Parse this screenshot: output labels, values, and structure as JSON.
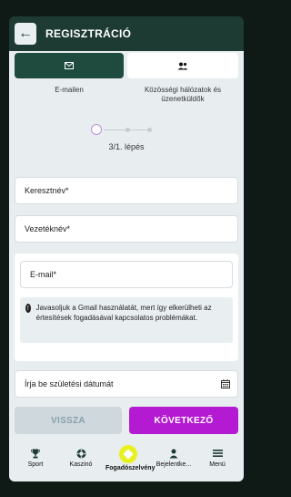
{
  "header": {
    "title": "REGISZTRÁCIÓ"
  },
  "tabs": [
    {
      "label": "E-mailen",
      "icon": "envelope-icon"
    },
    {
      "label": "Közösségi hálózatok és üzenetküldők",
      "icon": "users-icon"
    }
  ],
  "progress": {
    "step_text": "3/1. lépés"
  },
  "fields": {
    "first_name": {
      "placeholder": "Keresztnév*"
    },
    "last_name": {
      "placeholder": "Vezetéknév*"
    },
    "email": {
      "placeholder": "E-mail*"
    },
    "birthdate": {
      "placeholder": "Írja be születési dátumát"
    }
  },
  "notice": {
    "text": "Javasoljuk a Gmail használatát, mert így elkerülheti az értesítések fogadásával kapcsolatos problémákat."
  },
  "buttons": {
    "back": "VISSZA",
    "next": "KÖVETKEZŐ"
  },
  "bottom_nav": [
    {
      "label": "Sport",
      "icon": "trophy-icon"
    },
    {
      "label": "Kaszinó",
      "icon": "chip-icon"
    },
    {
      "label": "Fogadószelvény",
      "icon": "betslip-icon"
    },
    {
      "label": "Bejelentke...",
      "icon": "user-icon"
    },
    {
      "label": "Menü",
      "icon": "menu-icon"
    }
  ],
  "colors": {
    "header_bg": "#1d3a33",
    "active_tab": "#1e4b3e",
    "next_button": "#b41ad1",
    "center_circle": "#e8f11f"
  }
}
